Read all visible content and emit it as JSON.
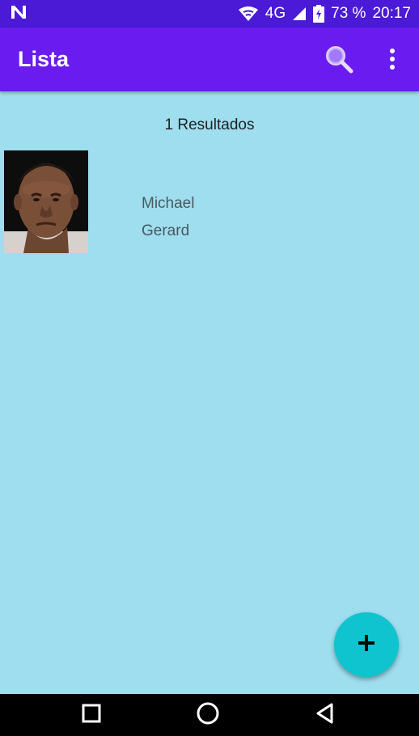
{
  "status_bar": {
    "network_type": "4G",
    "battery_percent": "73 %",
    "time": "20:17",
    "icons": [
      "notification-n-icon",
      "wifi-icon",
      "signal-icon",
      "battery-charging-icon"
    ]
  },
  "app_bar": {
    "title": "Lista",
    "icons": [
      "search-icon",
      "overflow-menu-icon"
    ]
  },
  "results": {
    "count_text": "1 Resultados"
  },
  "list": {
    "items": [
      {
        "first_name": "Michael",
        "last_name": "Gerard",
        "avatar": "person-photo"
      }
    ]
  },
  "fab": {
    "icon": "plus-icon"
  },
  "nav_bar": {
    "icons": [
      "recent-apps-icon",
      "home-icon",
      "back-icon"
    ]
  },
  "colors": {
    "status_bar": "#4a1ad6",
    "app_bar": "#6a1cf0",
    "background": "#9edeef",
    "fab": "#0fc4cf"
  }
}
